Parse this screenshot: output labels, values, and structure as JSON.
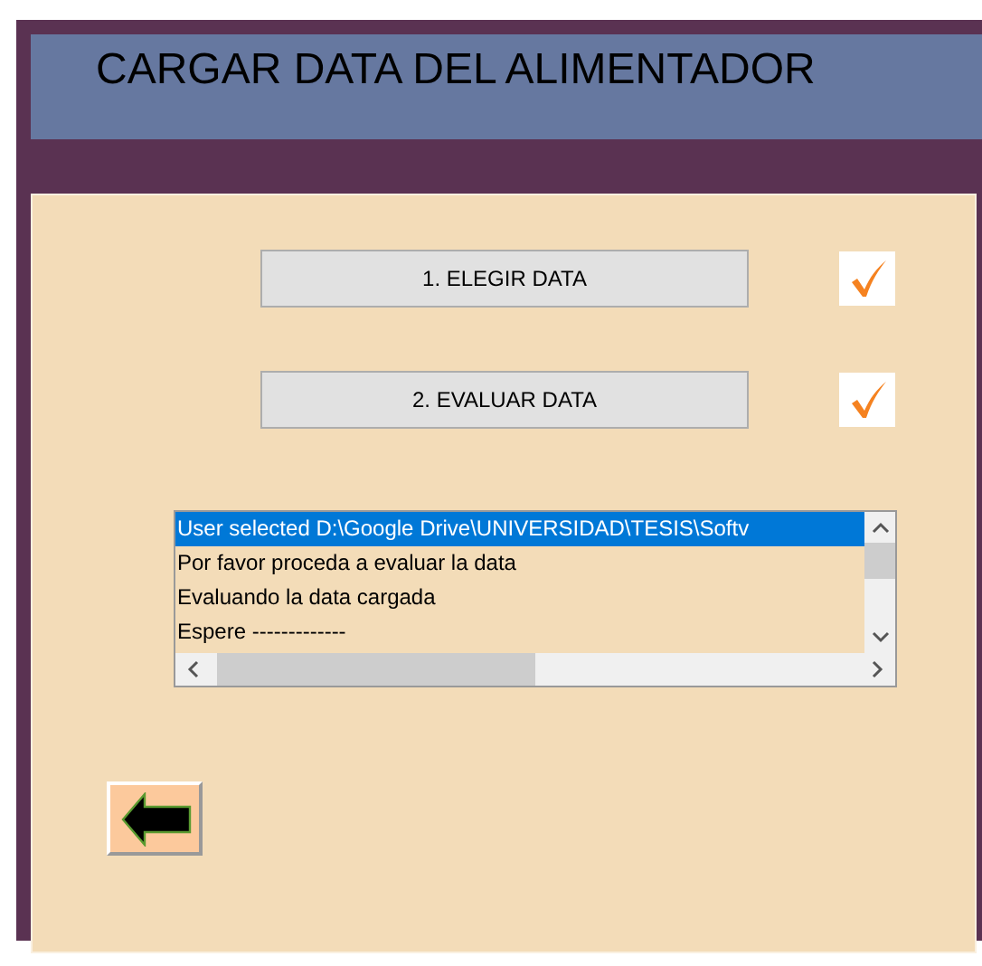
{
  "header": {
    "title": "CARGAR DATA DEL ALIMENTADOR"
  },
  "steps": [
    {
      "label": "1. ELEGIR DATA",
      "checked": true
    },
    {
      "label": "2. EVALUAR DATA",
      "checked": true
    }
  ],
  "log": {
    "items": [
      {
        "text": "User selected D:\\Google Drive\\UNIVERSIDAD\\TESIS\\Softv",
        "selected": true
      },
      {
        "text": "Por favor proceda a evaluar la data",
        "selected": false
      },
      {
        "text": "Evaluando la data cargada",
        "selected": false
      },
      {
        "text": "Espere -------------",
        "selected": false
      }
    ]
  }
}
